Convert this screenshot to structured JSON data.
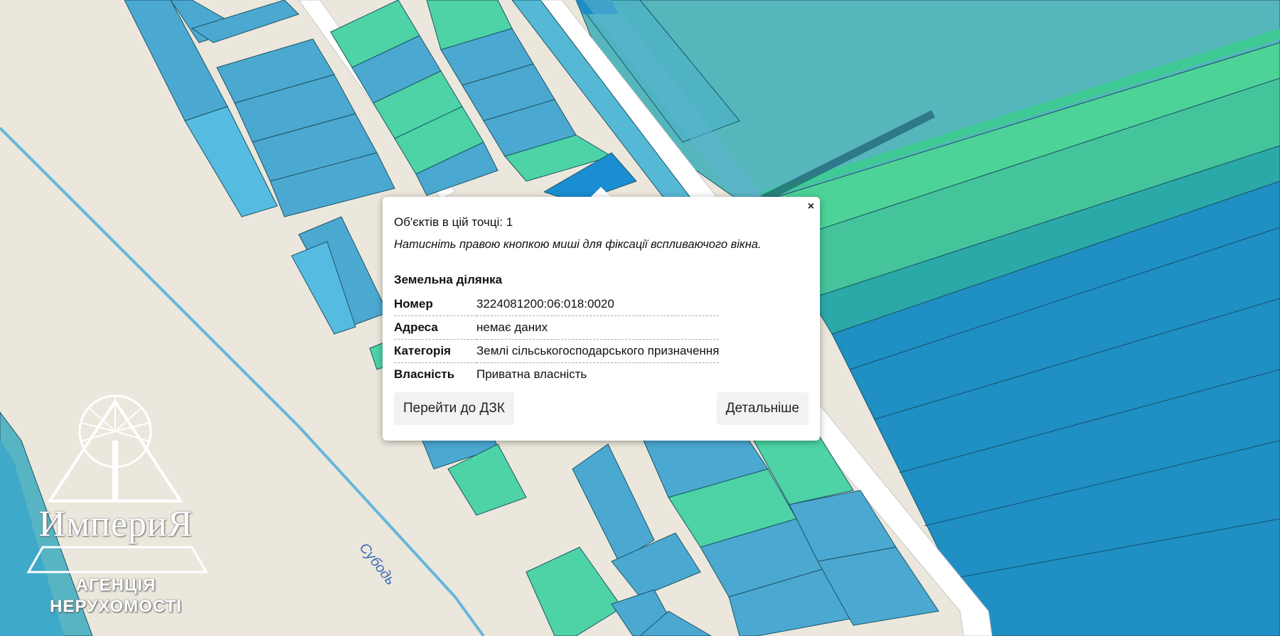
{
  "popup": {
    "close_label": "×",
    "count_text": "Об'єктів в цій точці: 1",
    "hint_text": "Натисніть правою кнопкою миші для фіксації вспливаючого вікна.",
    "section_title": "Земельна ділянка",
    "rows": [
      {
        "key": "Номер",
        "value": "3224081200:06:018:0020"
      },
      {
        "key": "Адреса",
        "value": "немає даних"
      },
      {
        "key": "Категорія",
        "value": "Землі сільськогосподарського призначення"
      },
      {
        "key": "Власність",
        "value": "Приватна власність"
      }
    ],
    "button_dzk": "Перейти до ДЗК",
    "button_details": "Детальніше"
  },
  "map": {
    "river_label": "Субодь",
    "colors": {
      "background": "#ebe7dc",
      "parcel_blue": "#4aa8d0",
      "parcel_green": "#4dd3a6",
      "parcel_teal": "#3fb4b8",
      "parcel_dark": "#1d8dc6",
      "selected": "#1a8ed0",
      "road": "#ffffff",
      "river": "#66b6dc"
    }
  },
  "watermark": {
    "title": "ИмпериЯ",
    "line1": "АГЕНЦІЯ",
    "line2": "НЕРУХОМОСТІ"
  }
}
